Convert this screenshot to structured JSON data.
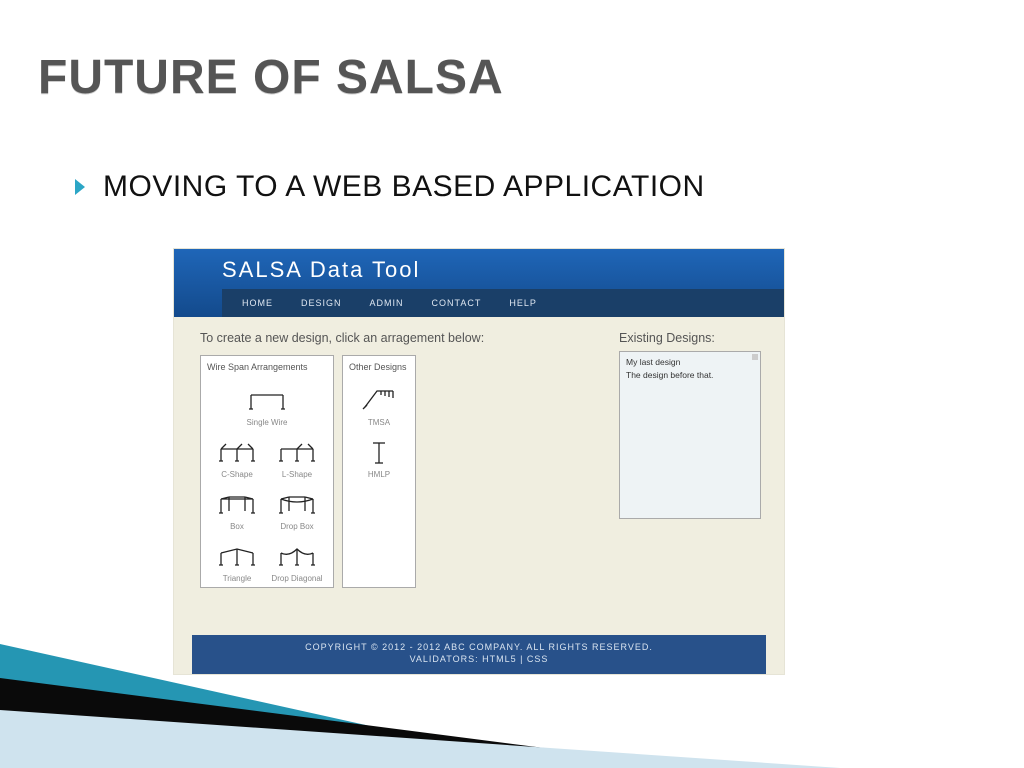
{
  "slide": {
    "title": "FUTURE OF SALSA",
    "bullet": "MOVING TO A WEB BASED APPLICATION"
  },
  "mock": {
    "app_title": "SALSA Data Tool",
    "nav": [
      "HOME",
      "DESIGN",
      "ADMIN",
      "CONTACT",
      "HELP"
    ],
    "prompt": "To create a new design, click an arragement below:",
    "panels": {
      "wire": {
        "title": "Wire Span Arrangements",
        "items": [
          "Single Wire",
          "C-Shape",
          "L-Shape",
          "Box",
          "Drop Box",
          "Triangle",
          "Drop Diagonal"
        ]
      },
      "other": {
        "title": "Other Designs",
        "items": [
          "TMSA",
          "HMLP"
        ]
      }
    },
    "existing": {
      "title": "Existing Designs:",
      "items": [
        "My last design",
        "The design before that."
      ]
    },
    "footer_line1": "COPYRIGHT © 2012 - 2012 ABC COMPANY. ALL RIGHTS RESERVED.",
    "footer_line2": "VALIDATORS: HTML5 | CSS"
  }
}
